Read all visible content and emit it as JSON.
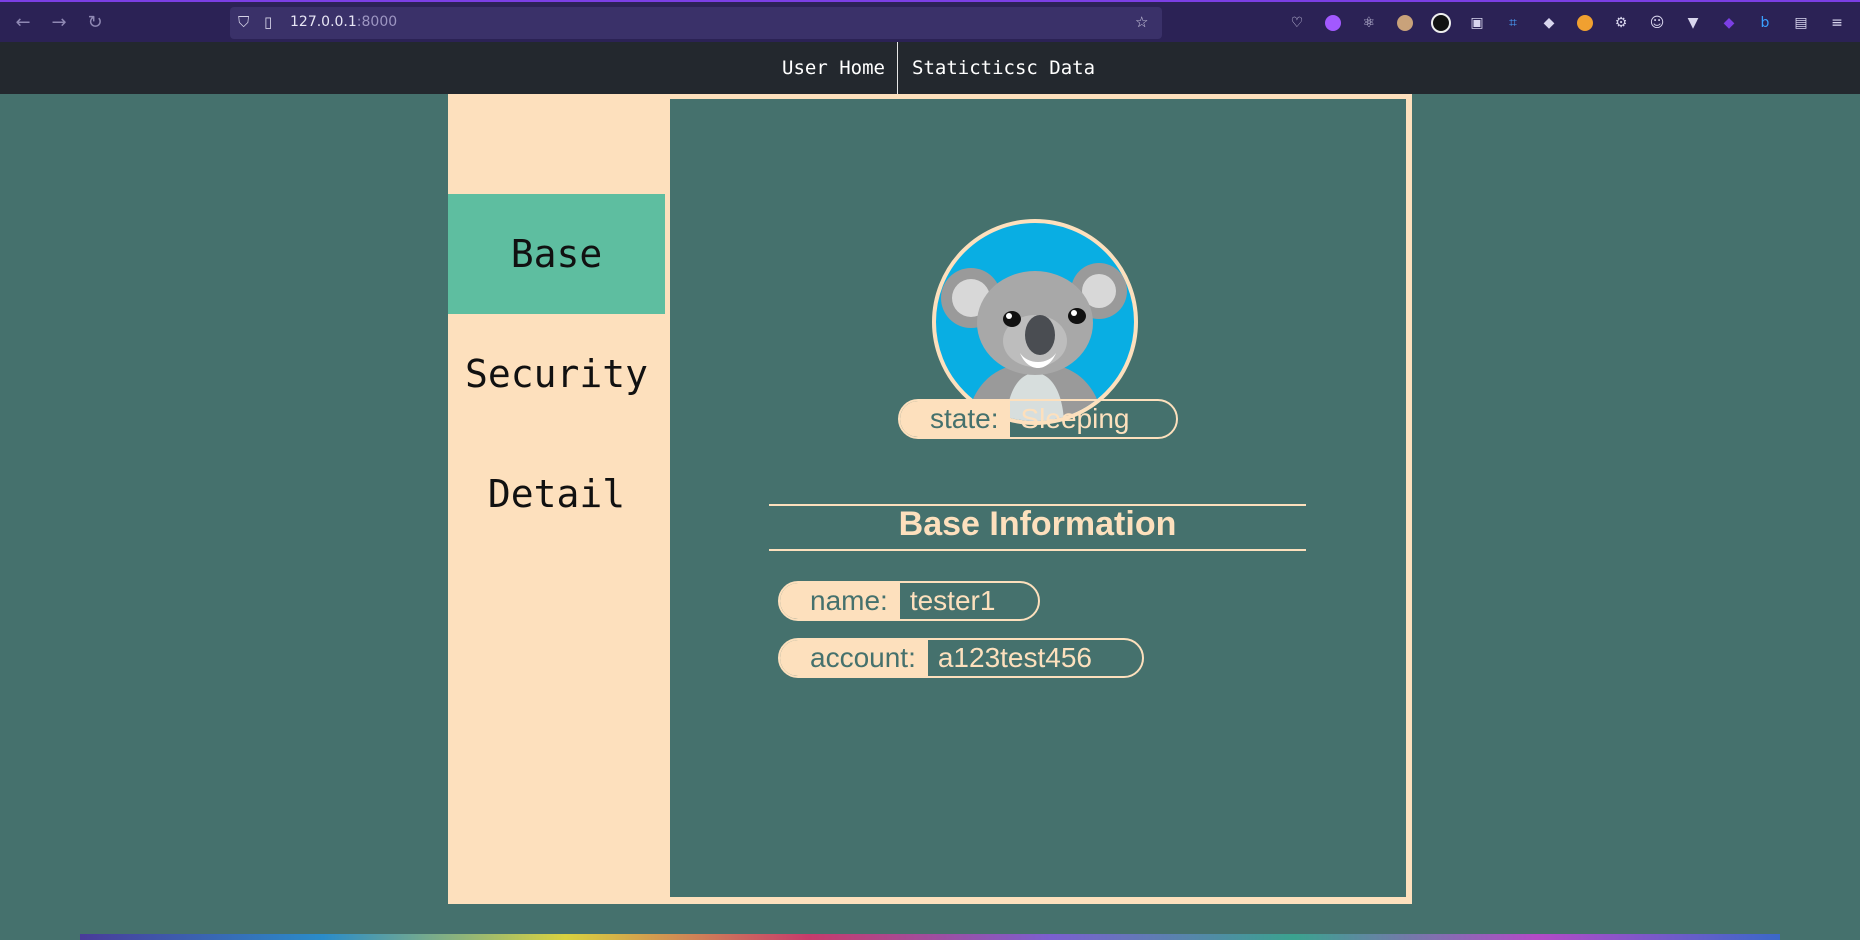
{
  "browser": {
    "url_host": "127.0.0.1",
    "url_port": ":8000"
  },
  "site_nav": {
    "items": [
      {
        "label": "User Home"
      },
      {
        "label": "Staticticsc Data"
      }
    ]
  },
  "sidebar": {
    "items": [
      {
        "label": "Base",
        "active": true
      },
      {
        "label": "Security",
        "active": false
      },
      {
        "label": "Detail",
        "active": false
      }
    ]
  },
  "profile": {
    "avatar": "koala-avatar",
    "state_label": "state:",
    "state_value": "Sleeping",
    "section_title": "Base Information",
    "name_label": "name:",
    "name_value": "tester1",
    "account_label": "account:",
    "account_value": "a123test456"
  },
  "colors": {
    "background": "#45716d",
    "cream": "#fde0bd",
    "active_tab": "#5ebea0",
    "navbar": "#23282e"
  }
}
